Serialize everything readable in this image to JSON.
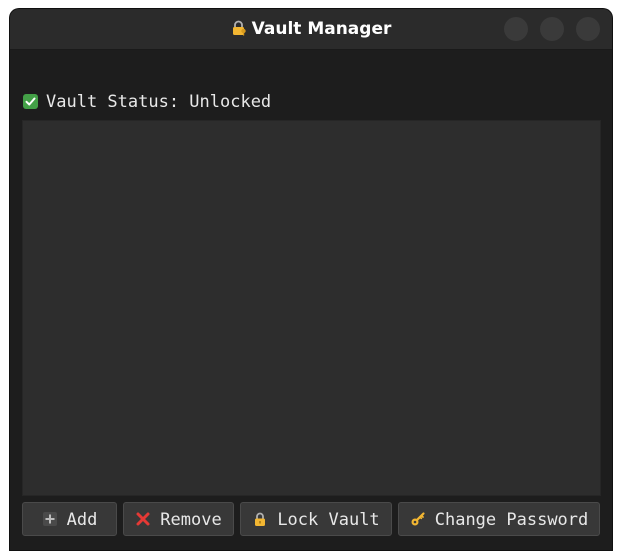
{
  "window": {
    "title": "Vault Manager",
    "title_icon": "lock-with-key-icon"
  },
  "status": {
    "icon": "check-icon",
    "text": "Vault Status: Unlocked"
  },
  "buttons": {
    "add": {
      "label": "Add",
      "icon": "plus-icon"
    },
    "remove": {
      "label": "Remove",
      "icon": "cross-icon"
    },
    "lock": {
      "label": "Lock Vault",
      "icon": "lock-icon"
    },
    "change_password": {
      "label": "Change Password",
      "icon": "key-icon"
    }
  },
  "colors": {
    "window_bg": "#1d1d1d",
    "titlebar_bg": "#2b2b2b",
    "list_bg": "#2d2d2d",
    "button_bg": "#383838",
    "text": "#e8e8e8",
    "success": "#43a047",
    "danger": "#e53935",
    "key": "#f2b632"
  }
}
